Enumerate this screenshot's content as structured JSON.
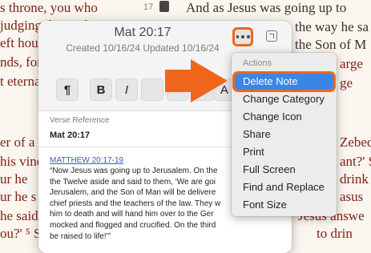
{
  "background": {
    "verse_marker": "17",
    "top_left_lines": [
      "s throne, you who",
      "judging the twelve",
      "eft hous",
      "nds, for",
      "t eterna"
    ],
    "top_right_lines": [
      "And as Jesus was going up to",
      "the way he sa",
      "the Son of M",
      "arge",
      "ge"
    ],
    "bottom_left_lines": [
      "er of a",
      "his vine",
      "ur he",
      "ur he s",
      "he said,",
      "ou?' ⁵ Sc"
    ],
    "bottom_right_lines": [
      "Zebed",
      "ant?' S",
      "drink",
      "asus",
      "Jesus answe",
      "to drin"
    ]
  },
  "note": {
    "title": "Mat 20:17",
    "subtitle": "Created 10/16/24 Updated 10/16/24",
    "toolbar": {
      "paragraph_label": "¶",
      "bold_label": "B",
      "italic_label": "I",
      "more_label": "A"
    },
    "verse_reference_label": "Verse Reference",
    "verse_reference_value": "Mat 20:17",
    "reference_link": "MATTHEW 20:17-19",
    "text_lines": [
      "“Now Jesus was going up to Jerusalem. On the",
      "the Twelve aside and said to them, ‘We are goi",
      "Jerusalem, and the Son of Man will be delivere",
      "chief priests and the teachers of the law. They w",
      "him to death and will hand him over to the Ger",
      "mocked and flogged and crucified. On the third",
      "be raised to life!’”"
    ]
  },
  "menu": {
    "header": "Actions",
    "items": [
      {
        "label": "Delete Note",
        "selected": true
      },
      {
        "label": "Change Category"
      },
      {
        "label": "Change Icon"
      },
      {
        "label": "Share"
      },
      {
        "label": "Print"
      },
      {
        "label": "Full Screen"
      },
      {
        "label": "Find and Replace"
      },
      {
        "label": "Font Size"
      }
    ]
  },
  "colors": {
    "highlight": "#f0651c",
    "selection": "#3a86e6",
    "scripture_red": "#7e2219"
  }
}
